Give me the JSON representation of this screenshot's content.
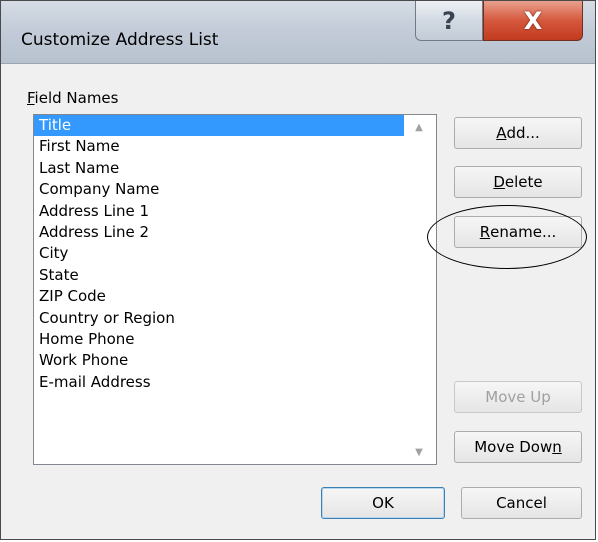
{
  "window": {
    "title": "Customize Address List",
    "help_glyph": "?",
    "close_glyph": "X"
  },
  "fields": {
    "label": "Field Names",
    "label_access": "F",
    "label_rest": "ield Names",
    "items": [
      "Title",
      "First Name",
      "Last Name",
      "Company Name",
      "Address Line 1",
      "Address Line 2",
      "City",
      "State",
      "ZIP Code",
      "Country or Region",
      "Home Phone",
      "Work Phone",
      "E-mail Address"
    ],
    "selected": "Title"
  },
  "buttons": {
    "add": {
      "access": "A",
      "rest": "dd..."
    },
    "delete": {
      "access": "D",
      "rest": "elete"
    },
    "rename": {
      "access": "R",
      "rest": "ename..."
    },
    "move_up": "Move Up",
    "move_down": {
      "text": "Move Dow",
      "access": "n"
    },
    "ok": "OK",
    "cancel": "Cancel"
  },
  "colors": {
    "selection": "#3399ff",
    "close_button": "#c23b1f"
  }
}
